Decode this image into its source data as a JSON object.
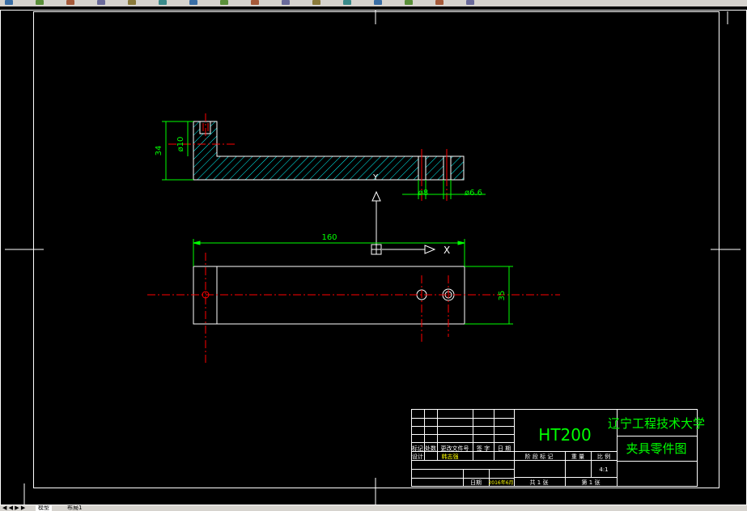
{
  "toolbar": {
    "icons": [
      "new-file-icon",
      "open-file-icon",
      "save-icon",
      "print-icon",
      "undo-icon",
      "redo-icon",
      "pan-icon",
      "zoom-icon",
      "line-icon",
      "polyline-icon",
      "circle-icon",
      "hatch-icon",
      "text-icon",
      "dimension-icon",
      "layer-icon",
      "properties-icon"
    ]
  },
  "status": {
    "model_tab": "模型",
    "layout_tab": "布局1"
  },
  "drawing": {
    "dims": {
      "d34": "34",
      "d10": "ø10",
      "d8": "ø8",
      "d66": "ø6.6",
      "d160": "160",
      "d35": "35"
    },
    "ucs": {
      "y": "Y",
      "x": "X"
    }
  },
  "title_block": {
    "material": "HT200",
    "university": "辽宁工程技术大学",
    "drawing_name": "夹具零件图",
    "headers": [
      "标记",
      "处数",
      "更改文件号",
      "签 字",
      "日 期"
    ],
    "design_label": "设计",
    "designer": "韩志强",
    "approve_label": "日期",
    "approve_date": "2016年6月",
    "stage_label": "阶 段 标 记",
    "weight_label": "重 量",
    "scale_label": "比 例",
    "scale_value": "4:1",
    "total_label": "共 1 张",
    "sheet_label": "第 1 张"
  },
  "colors": {
    "background": "#000000",
    "outline": "#ffffff",
    "center_line": "#ff0000",
    "hatch": "#00ffff",
    "dimension": "#00ff00",
    "title_text": "#00ff00"
  }
}
